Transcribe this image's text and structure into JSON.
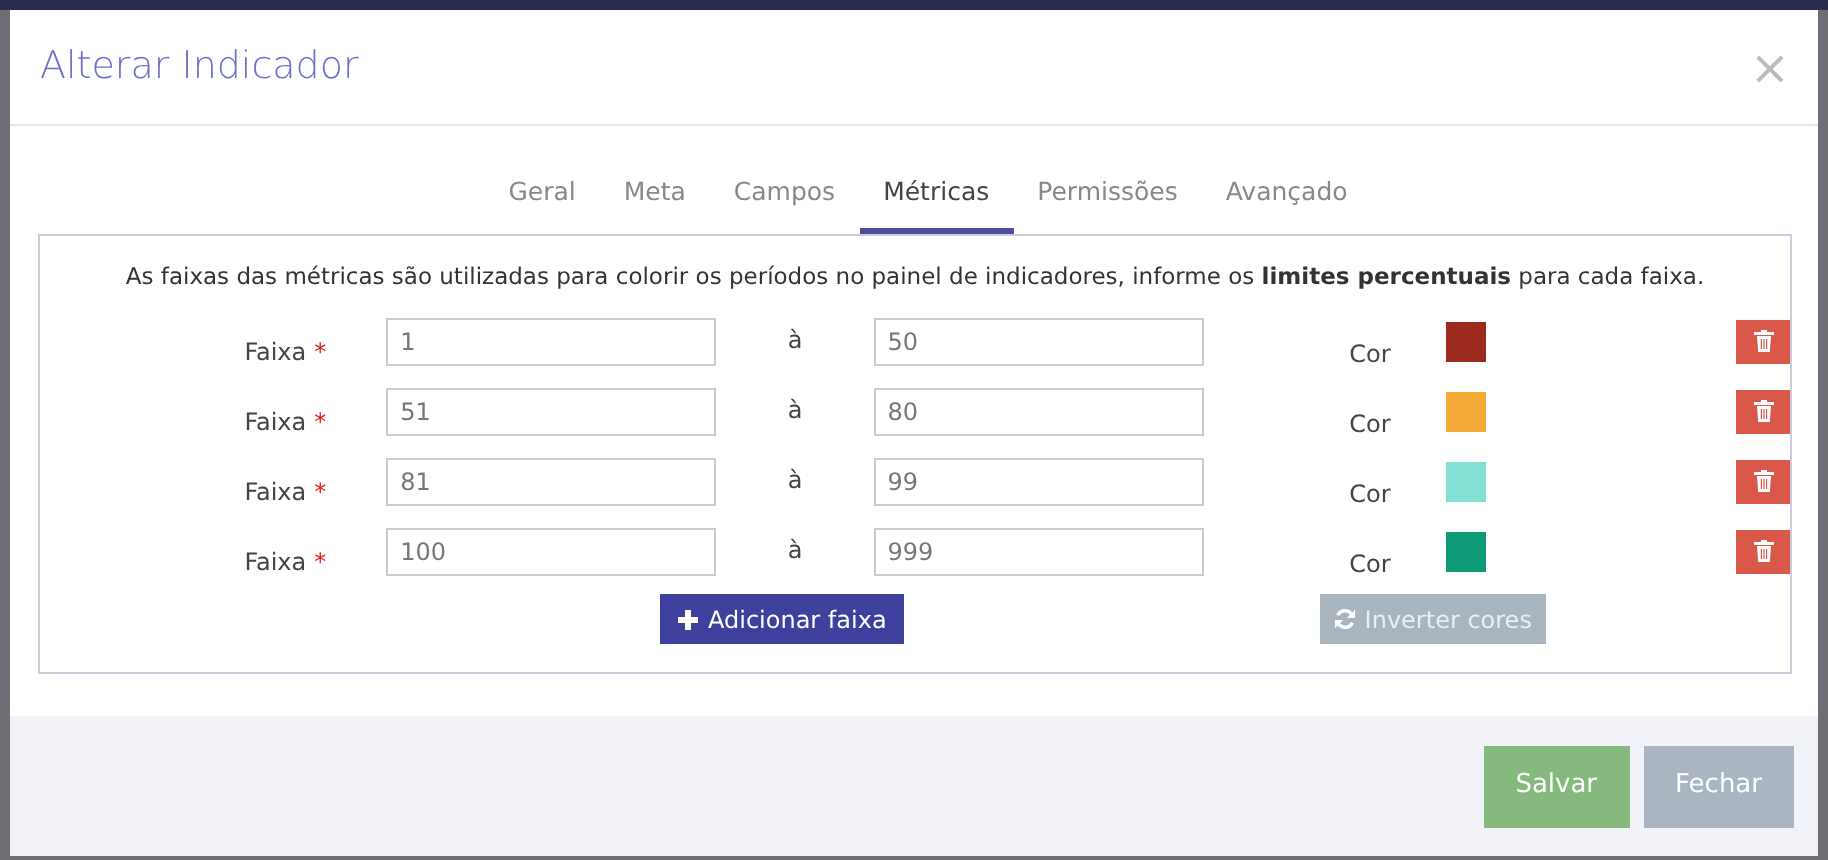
{
  "modal": {
    "title": "Alterar Indicador",
    "close": "×"
  },
  "tabs": [
    {
      "label": "Geral",
      "selected": false
    },
    {
      "label": "Meta",
      "selected": false
    },
    {
      "label": "Campos",
      "selected": false
    },
    {
      "label": "Métricas",
      "selected": true
    },
    {
      "label": "Permissões",
      "selected": false
    },
    {
      "label": "Avançado",
      "selected": false
    }
  ],
  "description": "As faixas das métricas são utilizadas para colorir os períodos no painel de indicadores, informe os **limites percentuais** para cada faixa.",
  "ranges": [
    {
      "label": "Faixa",
      "required_mark": "*",
      "from": "1",
      "separator": "à",
      "to": "50",
      "color_label": "Cor",
      "color": "#9c2a1e"
    },
    {
      "label": "Faixa",
      "required_mark": "*",
      "from": "51",
      "separator": "à",
      "to": "80",
      "color_label": "Cor",
      "color": "#f5a937"
    },
    {
      "label": "Faixa",
      "required_mark": "*",
      "from": "81",
      "separator": "à",
      "to": "99",
      "color_label": "Cor",
      "color": "#85e0d4"
    },
    {
      "label": "Faixa",
      "required_mark": "*",
      "from": "100",
      "separator": "à",
      "to": "999",
      "color_label": "Cor",
      "color": "#0d9a76"
    }
  ],
  "add_button": "Adicionar faixa",
  "invert_button": {
    "label": "Inverter cores",
    "disabled": true
  },
  "footer_buttons": [
    {
      "label": "Salvar",
      "kind": "primary"
    },
    {
      "label": "Fechar",
      "kind": "secondary"
    }
  ]
}
